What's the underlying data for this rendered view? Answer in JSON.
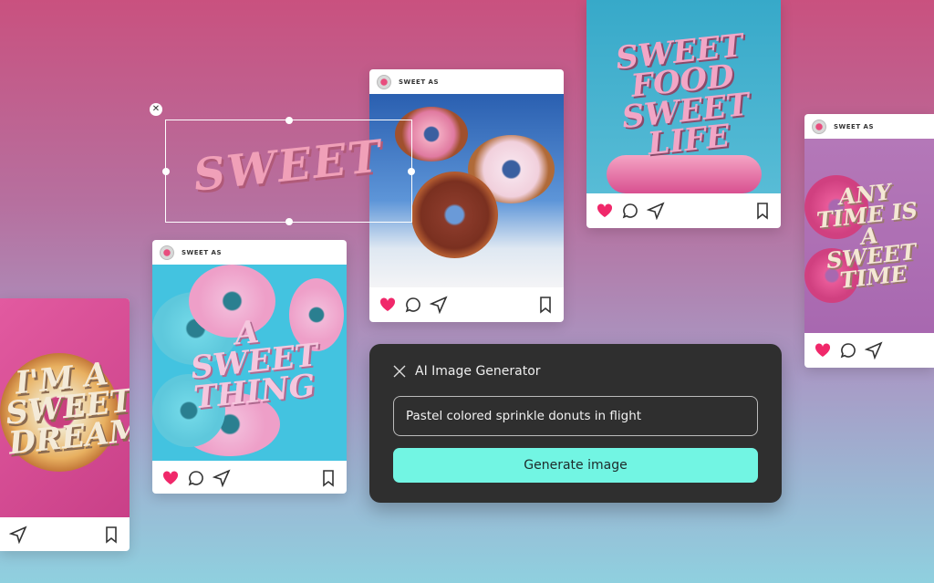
{
  "account_name": "SWEET AS",
  "colors": {
    "accent": "#72f5e3",
    "panel": "#2f2f2f",
    "heart": "#f0286a"
  },
  "cards": [
    {
      "lettering": "I'M A SWEET DREAM"
    },
    {
      "account": "SWEET AS",
      "lettering": "A SWEET THING"
    },
    {
      "account": "SWEET AS",
      "lettering": ""
    },
    {
      "lettering": "SWEET FOOD SWEET LIFE"
    },
    {
      "account": "SWEET AS",
      "lettering": "ANY TIME IS A SWEET TIME"
    }
  ],
  "canvas_text": "SWEET",
  "icons": [
    "heart-icon",
    "comment-icon",
    "share-icon",
    "bookmark-icon",
    "close-icon"
  ],
  "generator": {
    "title": "AI Image Generator",
    "prompt_value": "Pastel colored sprinkle donuts in flight",
    "button_label": "Generate image"
  }
}
